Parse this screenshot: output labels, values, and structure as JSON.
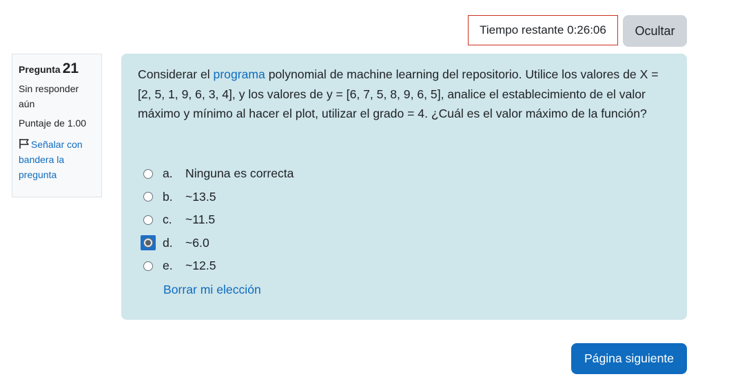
{
  "timer": {
    "label": "Tiempo restante",
    "value": "0:26:06"
  },
  "hide_button": "Ocultar",
  "info": {
    "question_label": "Pregunta",
    "question_number": "21",
    "status": "Sin responder aún",
    "marks": "Puntaje de 1.00",
    "flag_label": "Señalar con bandera la pregunta"
  },
  "question": {
    "text_before_link": "Considerar el ",
    "link_text": "programa",
    "text_after_link": " polynomial de machine learning del repositorio. Utilice los valores de X = [2, 5, 1, 9, 6, 3, 4], y los valores de y = [6, 7, 5, 8, 9, 6, 5], analice el establecimiento de el valor máximo y mínimo al hacer el plot, utilizar el grado = 4. ¿Cuál es el valor máximo de la función?",
    "answers": [
      {
        "letter": "a.",
        "text": "Ninguna es correcta",
        "selected": false
      },
      {
        "letter": "b.",
        "text": "~13.5",
        "selected": false
      },
      {
        "letter": "c.",
        "text": "~11.5",
        "selected": false
      },
      {
        "letter": "d.",
        "text": "~6.0",
        "selected": true
      },
      {
        "letter": "e.",
        "text": "~12.5",
        "selected": false
      }
    ],
    "clear_choice": "Borrar mi elección"
  },
  "next_button": "Página siguiente",
  "colors": {
    "accent": "#0f6cbf",
    "question_bg": "#cfe6ea",
    "timer_border": "#ca3120"
  }
}
